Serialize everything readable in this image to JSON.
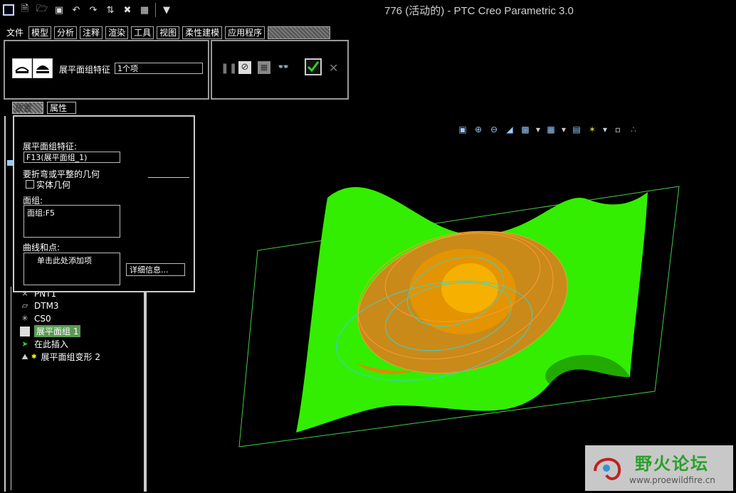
{
  "window": {
    "title": "776 (活动的) - PTC Creo Parametric 3.0"
  },
  "quick_access": {
    "icons": [
      "window-icon",
      "new-icon",
      "open-icon",
      "save-icon",
      "undo-icon",
      "redo-icon",
      "regenerate-icon",
      "close-window-icon",
      "switch-window-icon",
      "customize-icon"
    ]
  },
  "menu": {
    "items": [
      "文件",
      "模型",
      "分析",
      "注释",
      "渲染",
      "工具",
      "视图",
      "柔性建模",
      "应用程序"
    ]
  },
  "dashboard": {
    "feature_label": "展平面组特征",
    "feature_value": "1个项"
  },
  "subtabs": {
    "placement": "放置",
    "properties": "属性"
  },
  "placement_panel": {
    "feature_label": "展平面组特征:",
    "feature_value": "F13(展平面组_1)",
    "geometry_label": "要折弯或平整的几何",
    "solid_geometry": "实体几何",
    "quilt_label": "面组:",
    "quilt_value": "面组:F5",
    "curves_label": "曲线和点:",
    "curves_placeholder": "单击此处添加项",
    "details_button": "详细信息..."
  },
  "model_tree": {
    "items": [
      {
        "label": "PNT1",
        "icon": "point-icon"
      },
      {
        "label": "DTM3",
        "icon": "datum-plane-icon"
      },
      {
        "label": "CS0",
        "icon": "csys-icon"
      },
      {
        "label": "展平面组 1",
        "icon": "flatten-quilt-icon",
        "selected": true
      },
      {
        "label": "在此插入",
        "icon": "insert-here-icon"
      },
      {
        "label": "展平面组变形 2",
        "icon": "flatten-deform-icon"
      }
    ]
  },
  "watermark": {
    "text": "野火论坛",
    "url": "www.proewildfire.cn"
  },
  "colors": {
    "surface": "#33ee00",
    "solid": "#e08a00",
    "curve_cyan": "#3cd0d0",
    "plane": "#44cc44"
  }
}
